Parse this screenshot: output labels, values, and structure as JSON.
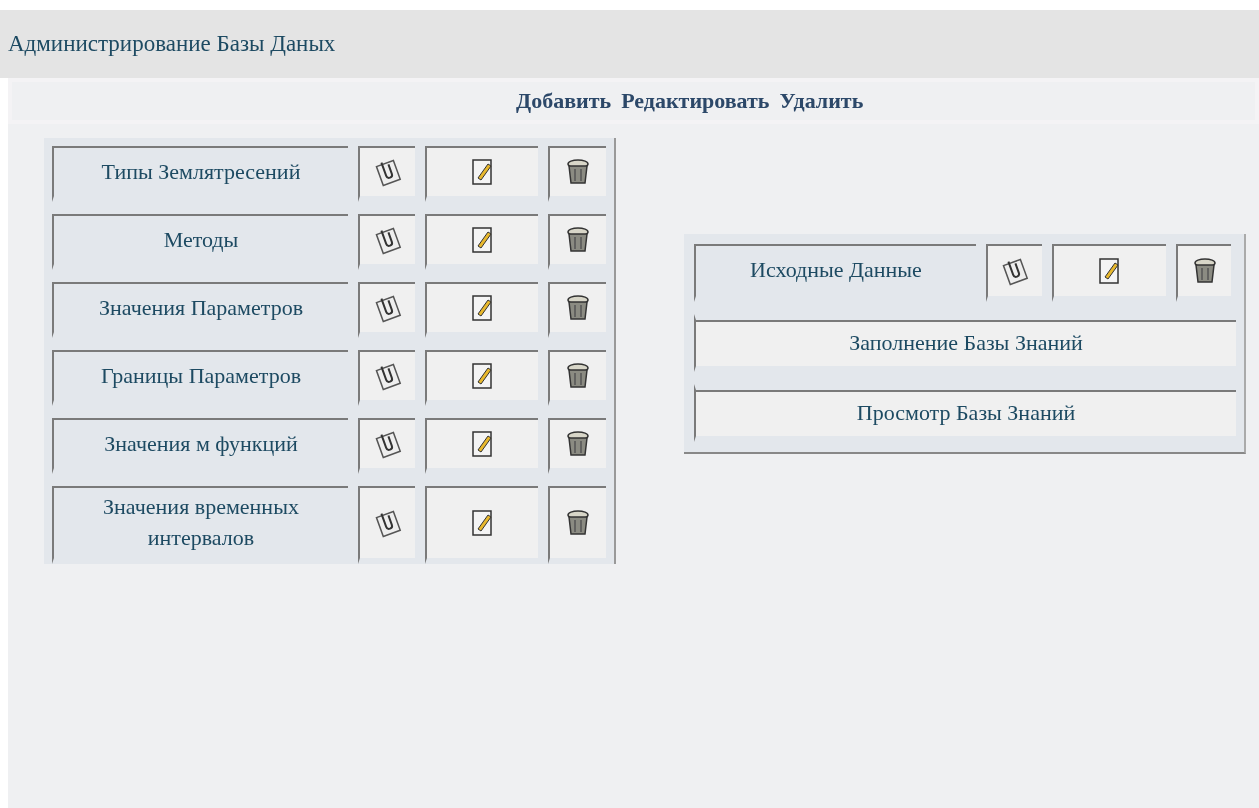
{
  "title": "Администрирование Базы Даных",
  "toolbar": [
    "Добавить",
    "Редактировать",
    "Удалить"
  ],
  "tables": [
    {
      "rows": [
        {
          "label": "Типы Землятресений"
        },
        {
          "label": "Методы"
        },
        {
          "label": "Значения Параметров"
        },
        {
          "label": "Границы Параметров"
        },
        {
          "label": "Значения м функций"
        },
        {
          "label": "Значения временных интервалов"
        }
      ]
    }
  ],
  "side_panel": {
    "rows": [
      {
        "kind": "record",
        "label": "Исходные Данные"
      },
      {
        "kind": "action",
        "label": "Заполнение Базы Знаний"
      },
      {
        "kind": "action",
        "label": "Просмотр Базы Знаний"
      }
    ]
  }
}
